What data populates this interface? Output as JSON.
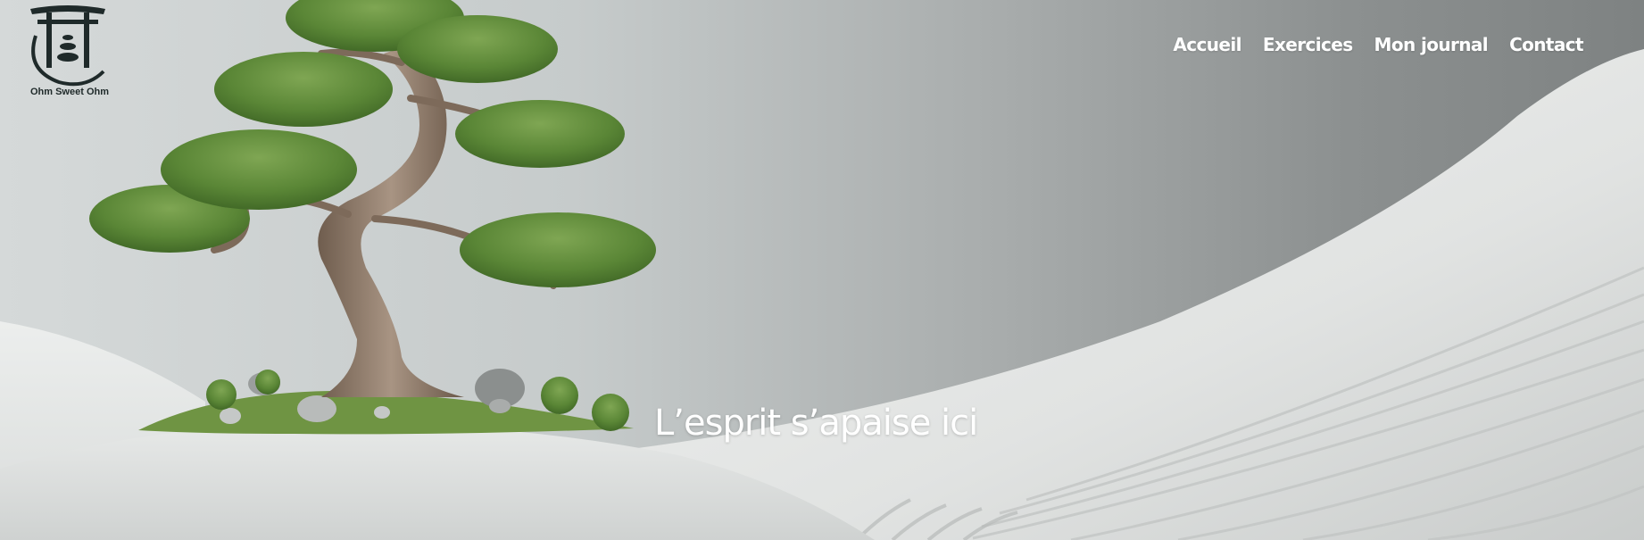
{
  "logo": {
    "text": "Ohm Sweet Ohm"
  },
  "nav": {
    "items": [
      {
        "label": "Accueil"
      },
      {
        "label": "Exercices"
      },
      {
        "label": "Mon journal"
      },
      {
        "label": "Contact"
      }
    ]
  },
  "hero": {
    "tagline": "L’esprit s’apaise ici"
  },
  "colors": {
    "sky_light": "#d5d9d9",
    "sky_dark": "#7e8282",
    "sand": "#e9ebea",
    "foliage": "#5c8a3a",
    "trunk": "#8a7563",
    "logo_ink": "#1f2a2a",
    "nav_text": "#ffffff"
  }
}
